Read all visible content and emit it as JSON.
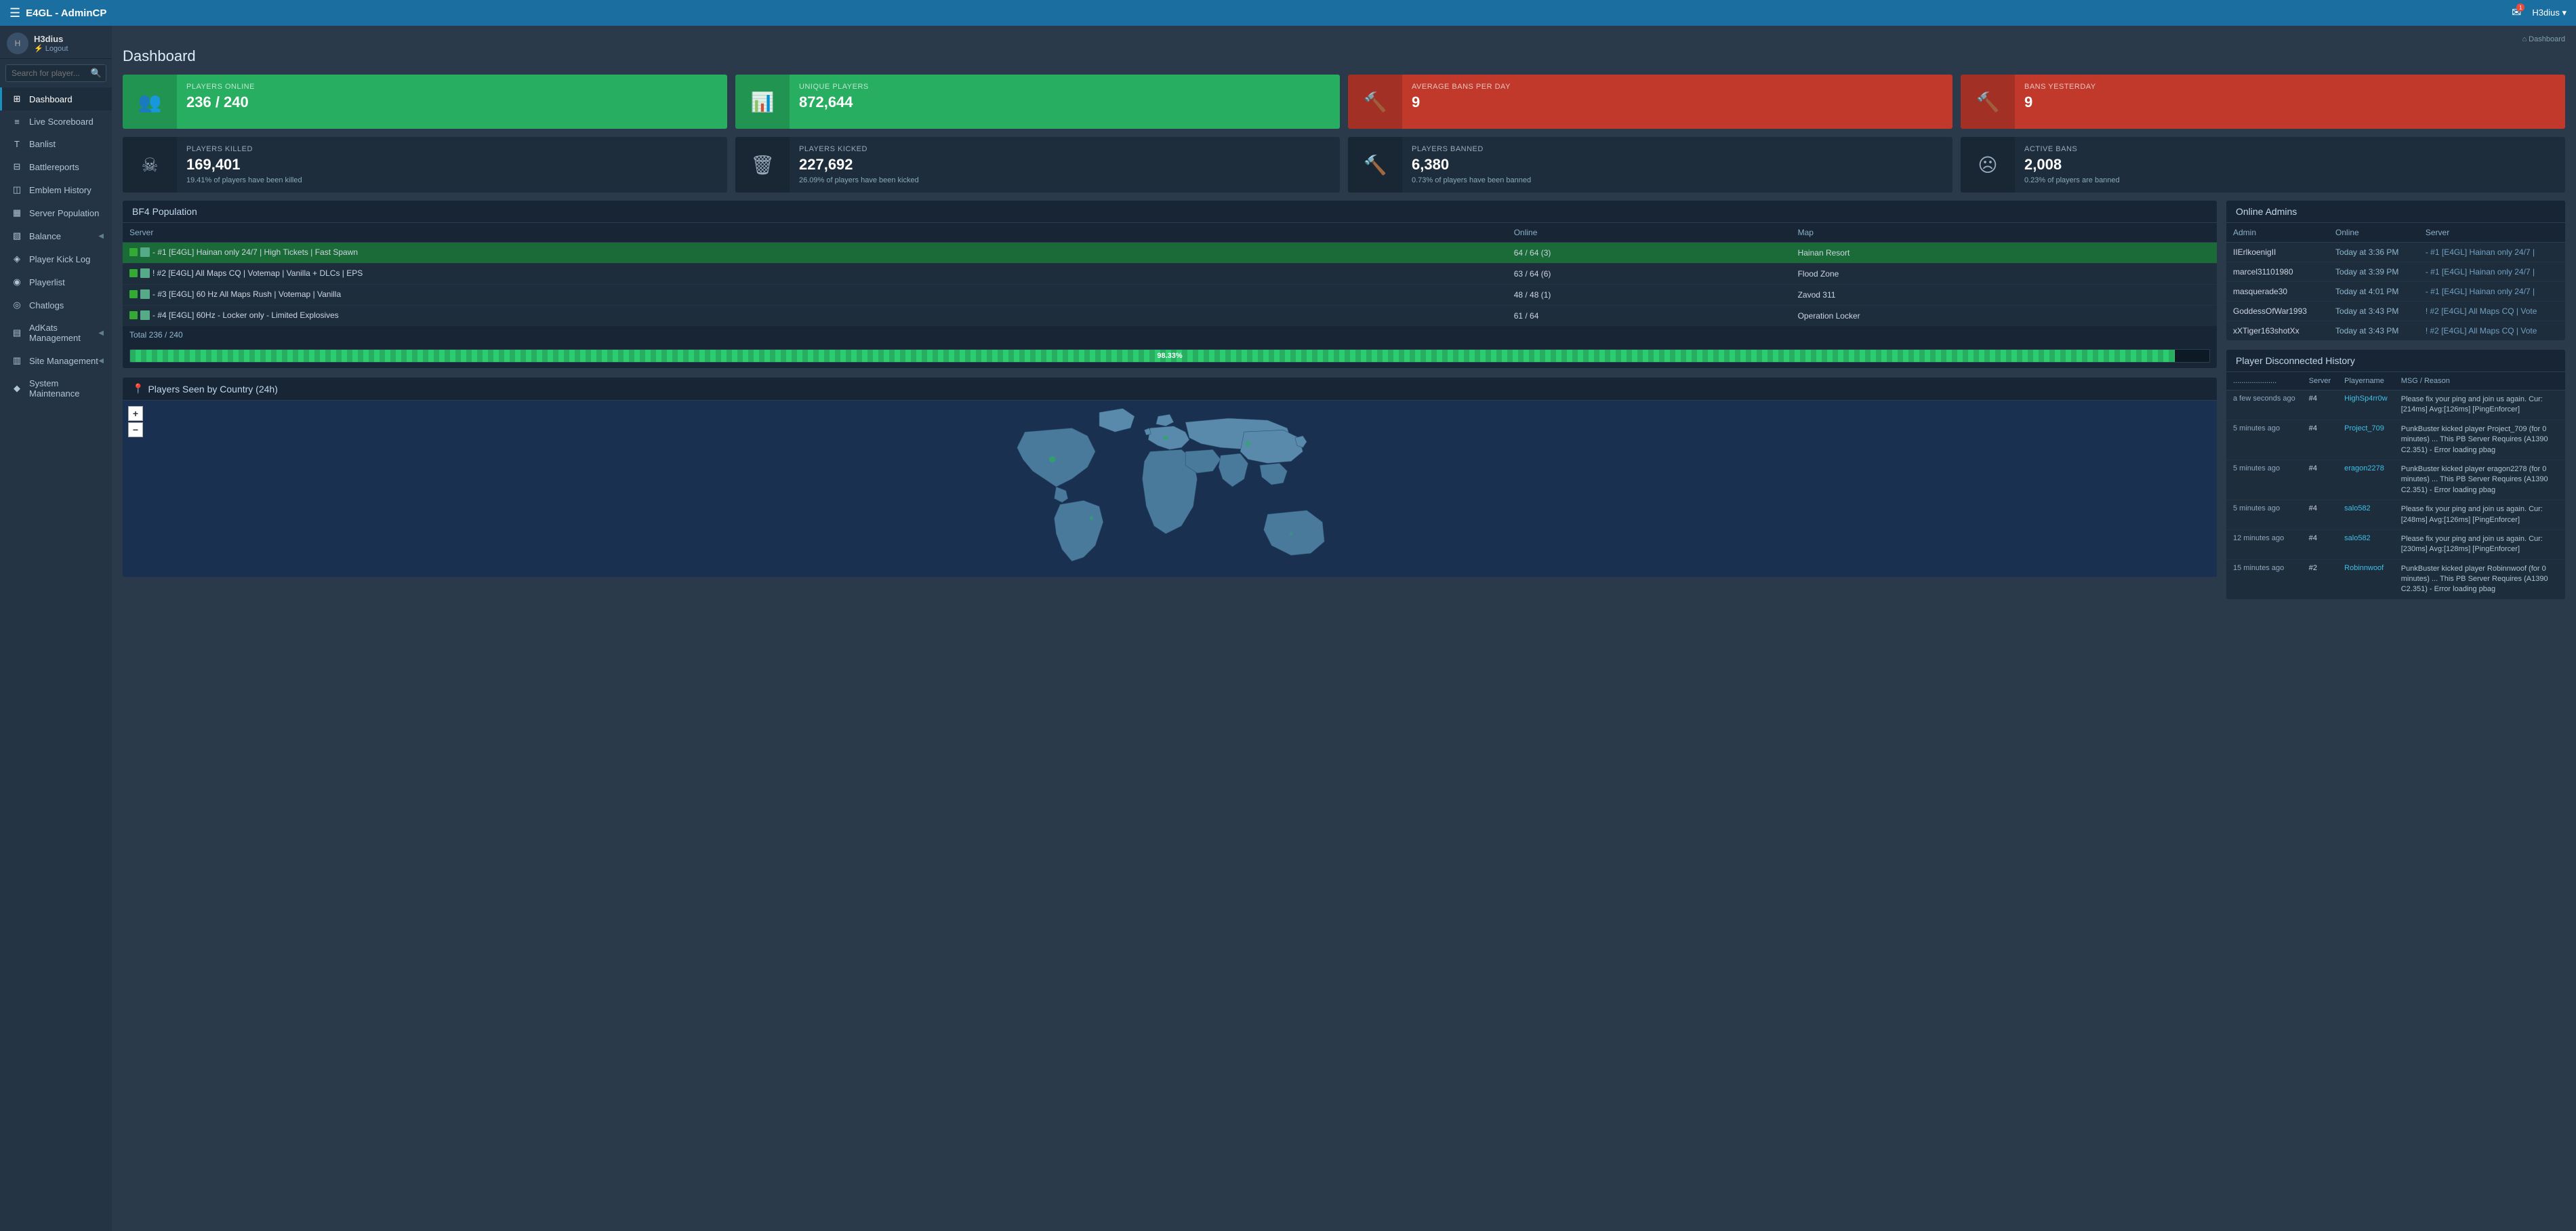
{
  "navbar": {
    "brand": "E4GL - AdminCP",
    "hamburger": "☰",
    "mail_icon": "✉",
    "mail_badge": "1",
    "user": "H3dius ▾"
  },
  "sidebar": {
    "username": "H3dius",
    "logout": "⚡ Logout",
    "search_placeholder": "Search for player...",
    "items": [
      {
        "id": "dashboard",
        "icon": "⊞",
        "label": "Dashboard",
        "active": true
      },
      {
        "id": "live-scoreboard",
        "icon": "≡",
        "label": "Live Scoreboard"
      },
      {
        "id": "banlist",
        "icon": "T",
        "label": "Banlist"
      },
      {
        "id": "battlereports",
        "icon": "⊟",
        "label": "Battlereports"
      },
      {
        "id": "emblem-history",
        "icon": "◫",
        "label": "Emblem History"
      },
      {
        "id": "server-population",
        "icon": "▦",
        "label": "Server Population"
      },
      {
        "id": "balance",
        "icon": "▧",
        "label": "Balance",
        "arrow": "◀"
      },
      {
        "id": "player-kick-log",
        "icon": "◈",
        "label": "Player Kick Log"
      },
      {
        "id": "playerlist",
        "icon": "◉",
        "label": "Playerlist"
      },
      {
        "id": "chatlogs",
        "icon": "◎",
        "label": "Chatlogs"
      },
      {
        "id": "adkats-management",
        "icon": "▤",
        "label": "AdKats Management",
        "arrow": "◀"
      },
      {
        "id": "site-management",
        "icon": "▥",
        "label": "Site Management",
        "arrow": "◀"
      },
      {
        "id": "system-maintenance",
        "icon": "◆",
        "label": "System Maintenance"
      }
    ]
  },
  "breadcrumb": "Dashboard",
  "page_title": "Dashboard",
  "stats": [
    {
      "id": "players-online",
      "color": "green",
      "icon": "👥",
      "label": "PLAYERS ONLINE",
      "value": "236 / 240",
      "sub": ""
    },
    {
      "id": "unique-players",
      "color": "green",
      "icon": "📊",
      "label": "UNIQUE PLAYERS",
      "value": "872,644",
      "sub": ""
    },
    {
      "id": "avg-bans",
      "color": "red",
      "icon": "🔨",
      "label": "AVERAGE BANS PER DAY",
      "value": "9",
      "sub": ""
    },
    {
      "id": "bans-yesterday",
      "color": "red",
      "icon": "🔨",
      "label": "BANS YESTERDAY",
      "value": "9",
      "sub": ""
    }
  ],
  "stats2": [
    {
      "id": "players-killed",
      "color": "dark",
      "icon": "☠",
      "label": "PLAYERS KILLED",
      "value": "169,401",
      "sub": "19.41% of players have been killed"
    },
    {
      "id": "players-kicked",
      "color": "dark",
      "icon": "🗑",
      "label": "PLAYERS KICKED",
      "value": "227,692",
      "sub": "26.09% of players have been kicked"
    },
    {
      "id": "players-banned",
      "color": "dark",
      "icon": "🔨",
      "label": "PLAYERS BANNED",
      "value": "6,380",
      "sub": "0.73% of players have been banned"
    },
    {
      "id": "active-bans",
      "color": "dark",
      "icon": "☹",
      "label": "ACTIVE BANS",
      "value": "2,008",
      "sub": "0.23% of players are banned"
    }
  ],
  "population": {
    "title": "BF4 Population",
    "columns": [
      "Server",
      "Online",
      "Map"
    ],
    "servers": [
      {
        "name": "- #1 [E4GL] Hainan only 24/7 | High Tickets | Fast Spawn",
        "online": "64 / 64 (3)",
        "map": "Hainan Resort",
        "highlight": true
      },
      {
        "name": "! #2 [E4GL] All Maps CQ | Votemap | Vanilla + DLCs | EPS",
        "online": "63 / 64 (6)",
        "map": "Flood Zone",
        "highlight": false
      },
      {
        "name": "- #3 [E4GL] 60 Hz All Maps Rush | Votemap | Vanilla",
        "online": "48 / 48 (1)",
        "map": "Zavod 311",
        "highlight": false
      },
      {
        "name": "- #4 [E4GL] 60Hz - Locker only - Limited Explosives",
        "online": "61 / 64",
        "map": "Operation Locker",
        "highlight": false
      }
    ],
    "total": "Total  236 / 240",
    "progress_pct": "98.33%",
    "progress_width": "98.33"
  },
  "map": {
    "title": "Players Seen by Country (24h)",
    "zoom_in": "+",
    "zoom_out": "−"
  },
  "online_admins": {
    "title": "Online Admins",
    "columns": [
      "Admin",
      "Online",
      "Server"
    ],
    "rows": [
      {
        "admin": "IIErlkoenigII",
        "online": "Today at 3:36 PM",
        "server": "- #1 [E4GL] Hainan only 24/7 |"
      },
      {
        "admin": "marcel31101980",
        "online": "Today at 3:39 PM",
        "server": "- #1 [E4GL] Hainan only 24/7 |"
      },
      {
        "admin": "masquerade30",
        "online": "Today at 4:01 PM",
        "server": "- #1 [E4GL] Hainan only 24/7 |"
      },
      {
        "admin": "GoddessOfWar1993",
        "online": "Today at 3:43 PM",
        "server": "! #2 [E4GL] All Maps CQ | Vote"
      },
      {
        "admin": "xXTiger163shotXx",
        "online": "Today at 3:43 PM",
        "server": "! #2 [E4GL] All Maps CQ | Vote"
      }
    ]
  },
  "disconnected": {
    "title": "Player Disconnected History",
    "columns": [
      "...................",
      "Server",
      "Playername",
      "MSG / Reason"
    ],
    "rows": [
      {
        "time": "a few seconds ago",
        "server": "#4",
        "player": "HighSp4rr0w",
        "msg": "Please fix your ping and join us again. Cur:[214ms] Avg:[126ms] [PingEnforcer]"
      },
      {
        "time": "5 minutes ago",
        "server": "#4",
        "player": "Project_709",
        "msg": "PunkBuster kicked player Project_709 (for 0 minutes) ... This PB Server Requires (A1390 C2.351) - Error loading pbag"
      },
      {
        "time": "5 minutes ago",
        "server": "#4",
        "player": "eragon2278",
        "msg": "PunkBuster kicked player eragon2278 (for 0 minutes) ... This PB Server Requires (A1390 C2.351) - Error loading pbag"
      },
      {
        "time": "5 minutes ago",
        "server": "#4",
        "player": "salo582",
        "msg": "Please fix your ping and join us again. Cur:[248ms] Avg:[126ms] [PingEnforcer]"
      },
      {
        "time": "12 minutes ago",
        "server": "#4",
        "player": "salo582",
        "msg": "Please fix your ping and join us again. Cur:[230ms] Avg:[128ms] [PingEnforcer]"
      },
      {
        "time": "15 minutes ago",
        "server": "#2",
        "player": "Robinnwoof",
        "msg": "PunkBuster kicked player Robinnwoof (for 0 minutes) ... This PB Server Requires (A1390 C2.351) - Error loading pbag"
      }
    ]
  }
}
